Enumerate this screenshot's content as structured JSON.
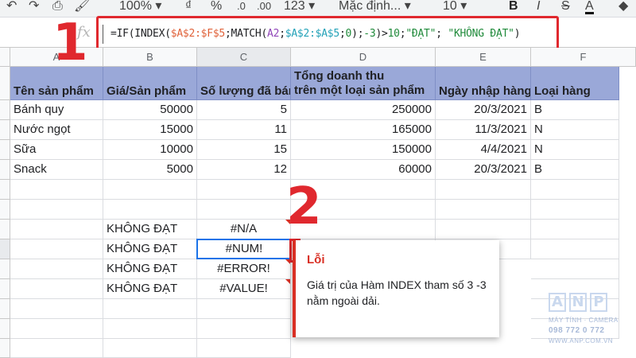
{
  "toolbar": {
    "zoom": "100%",
    "currency": "₫",
    "percent": "%",
    "decimal_dec": ".0",
    "decimal_inc": ".00",
    "format": "123",
    "font": "Mặc định...",
    "font_size": "10",
    "bold": "B",
    "italic": "I",
    "strike": "S",
    "text_color": "A"
  },
  "formula_bar": {
    "fx": "fx",
    "parts": {
      "p1": "=IF(INDEX(",
      "ref1": "$A$2:$F$5",
      "p2": ";MATCH(",
      "ref2": "A2",
      "p3": ";",
      "ref3": "$A$2:$A$5",
      "p4": ";",
      "num0": "0",
      "p5": ");",
      "num3": "-3",
      "p6": ")>",
      "num10": "10",
      "p7": ";",
      "str1": "\"ĐẠT\"",
      "p8": "; ",
      "str2": "\"KHÔNG ĐẠT\"",
      "p9": ")"
    }
  },
  "columns": [
    "A",
    "B",
    "C",
    "D",
    "E",
    "F"
  ],
  "table": {
    "headers": [
      "Tên sản phẩm",
      "Giá/Sản phẩm",
      "Số lượng đã bán",
      "Tổng doanh thu",
      "Ngày nhập hàng",
      "Loại hàng"
    ],
    "header_line2": "trên một loại sản phẩm",
    "rows": [
      [
        "Bánh quy",
        "50000",
        "5",
        "250000",
        "20/3/2021",
        "B"
      ],
      [
        "Nước ngọt",
        "15000",
        "11",
        "165000",
        "11/3/2021",
        "N"
      ],
      [
        "Sữa",
        "10000",
        "15",
        "150000",
        "4/4/2021",
        "N"
      ],
      [
        "Snack",
        "5000",
        "12",
        "60000",
        "20/3/2021",
        "B"
      ]
    ]
  },
  "results": [
    {
      "label": "KHÔNG ĐẠT",
      "error": "#N/A"
    },
    {
      "label": "KHÔNG ĐẠT",
      "error": "#NUM!"
    },
    {
      "label": "KHÔNG ĐẠT",
      "error": "#ERROR!"
    },
    {
      "label": "KHÔNG ĐẠT",
      "error": "#VALUE!"
    }
  ],
  "annotations": {
    "step1": "1",
    "step2": "2"
  },
  "tooltip": {
    "title": "Lỗi",
    "body": "Giá trị của Hàm INDEX tham số 3 -3 nằm ngoài dải."
  },
  "logo": {
    "letters": [
      "A",
      "N",
      "P"
    ],
    "line1": "MÁY TÍNH · CAMERA",
    "line2": "098 772 0 772",
    "line3": "WWW.ANP.COM.VN"
  },
  "colors": {
    "header_fill": "#9aa8d8",
    "annotation_red": "#e0282e",
    "error_red": "#d93025",
    "selection_blue": "#1a73e8"
  }
}
